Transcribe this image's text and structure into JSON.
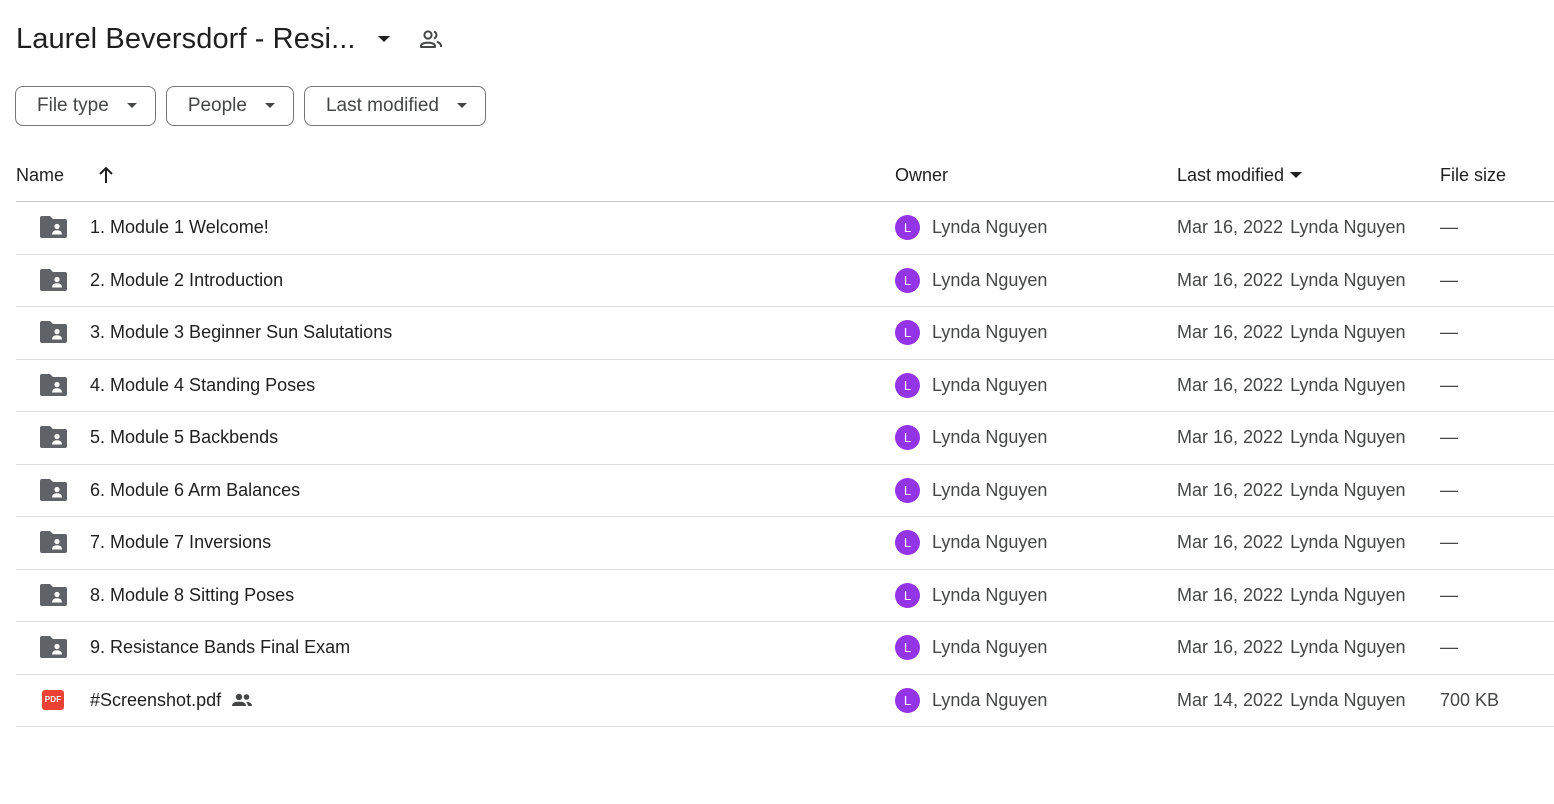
{
  "folder": {
    "title": "Laurel Beversdorf - Resi...",
    "shared_icon": "people-outline-icon",
    "menu_icon": "caret-down-icon"
  },
  "filters": [
    {
      "label": "File type"
    },
    {
      "label": "People"
    },
    {
      "label": "Last modified"
    }
  ],
  "columns": {
    "name": "Name",
    "owner": "Owner",
    "last_modified": "Last modified",
    "file_size": "File size",
    "sort_icon": "arrow-up-icon",
    "sort_direction_icon": "caret-down-icon"
  },
  "colors": {
    "avatar": "#9334e6",
    "folder_icon": "#5f6368",
    "pdf_icon": "#ea4335"
  },
  "files": [
    {
      "name": "1. Module 1 Welcome!",
      "icon": "shared-folder-icon",
      "owner_initial": "L",
      "owner": "Lynda Nguyen",
      "modified_date": "Mar 16, 2022",
      "modified_by": "Lynda Nguyen",
      "size": "—"
    },
    {
      "name": "2. Module 2 Introduction",
      "icon": "shared-folder-icon",
      "owner_initial": "L",
      "owner": "Lynda Nguyen",
      "modified_date": "Mar 16, 2022",
      "modified_by": "Lynda Nguyen",
      "size": "—"
    },
    {
      "name": "3. Module 3 Beginner Sun Salutations",
      "icon": "shared-folder-icon",
      "owner_initial": "L",
      "owner": "Lynda Nguyen",
      "modified_date": "Mar 16, 2022",
      "modified_by": "Lynda Nguyen",
      "size": "—"
    },
    {
      "name": "4. Module 4 Standing Poses",
      "icon": "shared-folder-icon",
      "owner_initial": "L",
      "owner": "Lynda Nguyen",
      "modified_date": "Mar 16, 2022",
      "modified_by": "Lynda Nguyen",
      "size": "—"
    },
    {
      "name": "5. Module 5 Backbends",
      "icon": "shared-folder-icon",
      "owner_initial": "L",
      "owner": "Lynda Nguyen",
      "modified_date": "Mar 16, 2022",
      "modified_by": "Lynda Nguyen",
      "size": "—"
    },
    {
      "name": "6. Module 6 Arm Balances",
      "icon": "shared-folder-icon",
      "owner_initial": "L",
      "owner": "Lynda Nguyen",
      "modified_date": "Mar 16, 2022",
      "modified_by": "Lynda Nguyen",
      "size": "—"
    },
    {
      "name": "7. Module 7 Inversions",
      "icon": "shared-folder-icon",
      "owner_initial": "L",
      "owner": "Lynda Nguyen",
      "modified_date": "Mar 16, 2022",
      "modified_by": "Lynda Nguyen",
      "size": "—"
    },
    {
      "name": "8. Module 8 Sitting Poses",
      "icon": "shared-folder-icon",
      "owner_initial": "L",
      "owner": "Lynda Nguyen",
      "modified_date": "Mar 16, 2022",
      "modified_by": "Lynda Nguyen",
      "size": "—"
    },
    {
      "name": "9. Resistance Bands Final Exam",
      "icon": "shared-folder-icon",
      "owner_initial": "L",
      "owner": "Lynda Nguyen",
      "modified_date": "Mar 16, 2022",
      "modified_by": "Lynda Nguyen",
      "size": "—"
    },
    {
      "name": "#Screenshot.pdf",
      "icon": "pdf-icon",
      "pdf_label": "PDF",
      "shared": true,
      "owner_initial": "L",
      "owner": "Lynda Nguyen",
      "modified_date": "Mar 14, 2022",
      "modified_by": "Lynda Nguyen",
      "size": "700 KB"
    }
  ]
}
